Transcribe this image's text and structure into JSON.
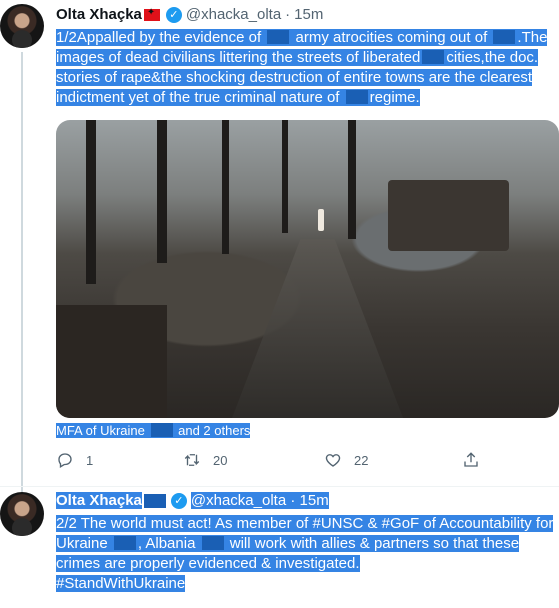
{
  "tweet1": {
    "name": "Olta Xhaçka",
    "handle": "@xhacka_olta",
    "separator": "·",
    "time": "15m",
    "text_parts": [
      "1/2Appalled by the evidence of",
      "army atrocities coming out of",
      ".The images of dead civilians littering the streets of liberated",
      "cities,the doc. stories of rape&the shocking destruction of entire towns are the clearest indictment yet of the true criminal nature of",
      "regime."
    ],
    "tagged_text": "MFA of Ukraine",
    "tagged_more": "and 2 others",
    "actions": {
      "replies": "1",
      "retweets": "20",
      "likes": "22"
    }
  },
  "tweet2": {
    "name": "Olta Xhaçka",
    "handle": "@xhacka_olta",
    "separator": "·",
    "time": "15m",
    "text_parts": [
      "2/2 The world must act! As member of #UNSC & #GoF of Accountability for Ukraine",
      ", Albania",
      "will work with allies & partners so that these crimes are properly evidenced & investigated.",
      "#StandWithUkraine"
    ]
  },
  "colors": {
    "selection": "#3584e4",
    "verified": "#1d9bf0",
    "muted": "#536471"
  },
  "icons": [
    "verified-badge-icon",
    "flag-albania-icon",
    "reply-icon",
    "retweet-icon",
    "like-icon",
    "share-icon"
  ]
}
